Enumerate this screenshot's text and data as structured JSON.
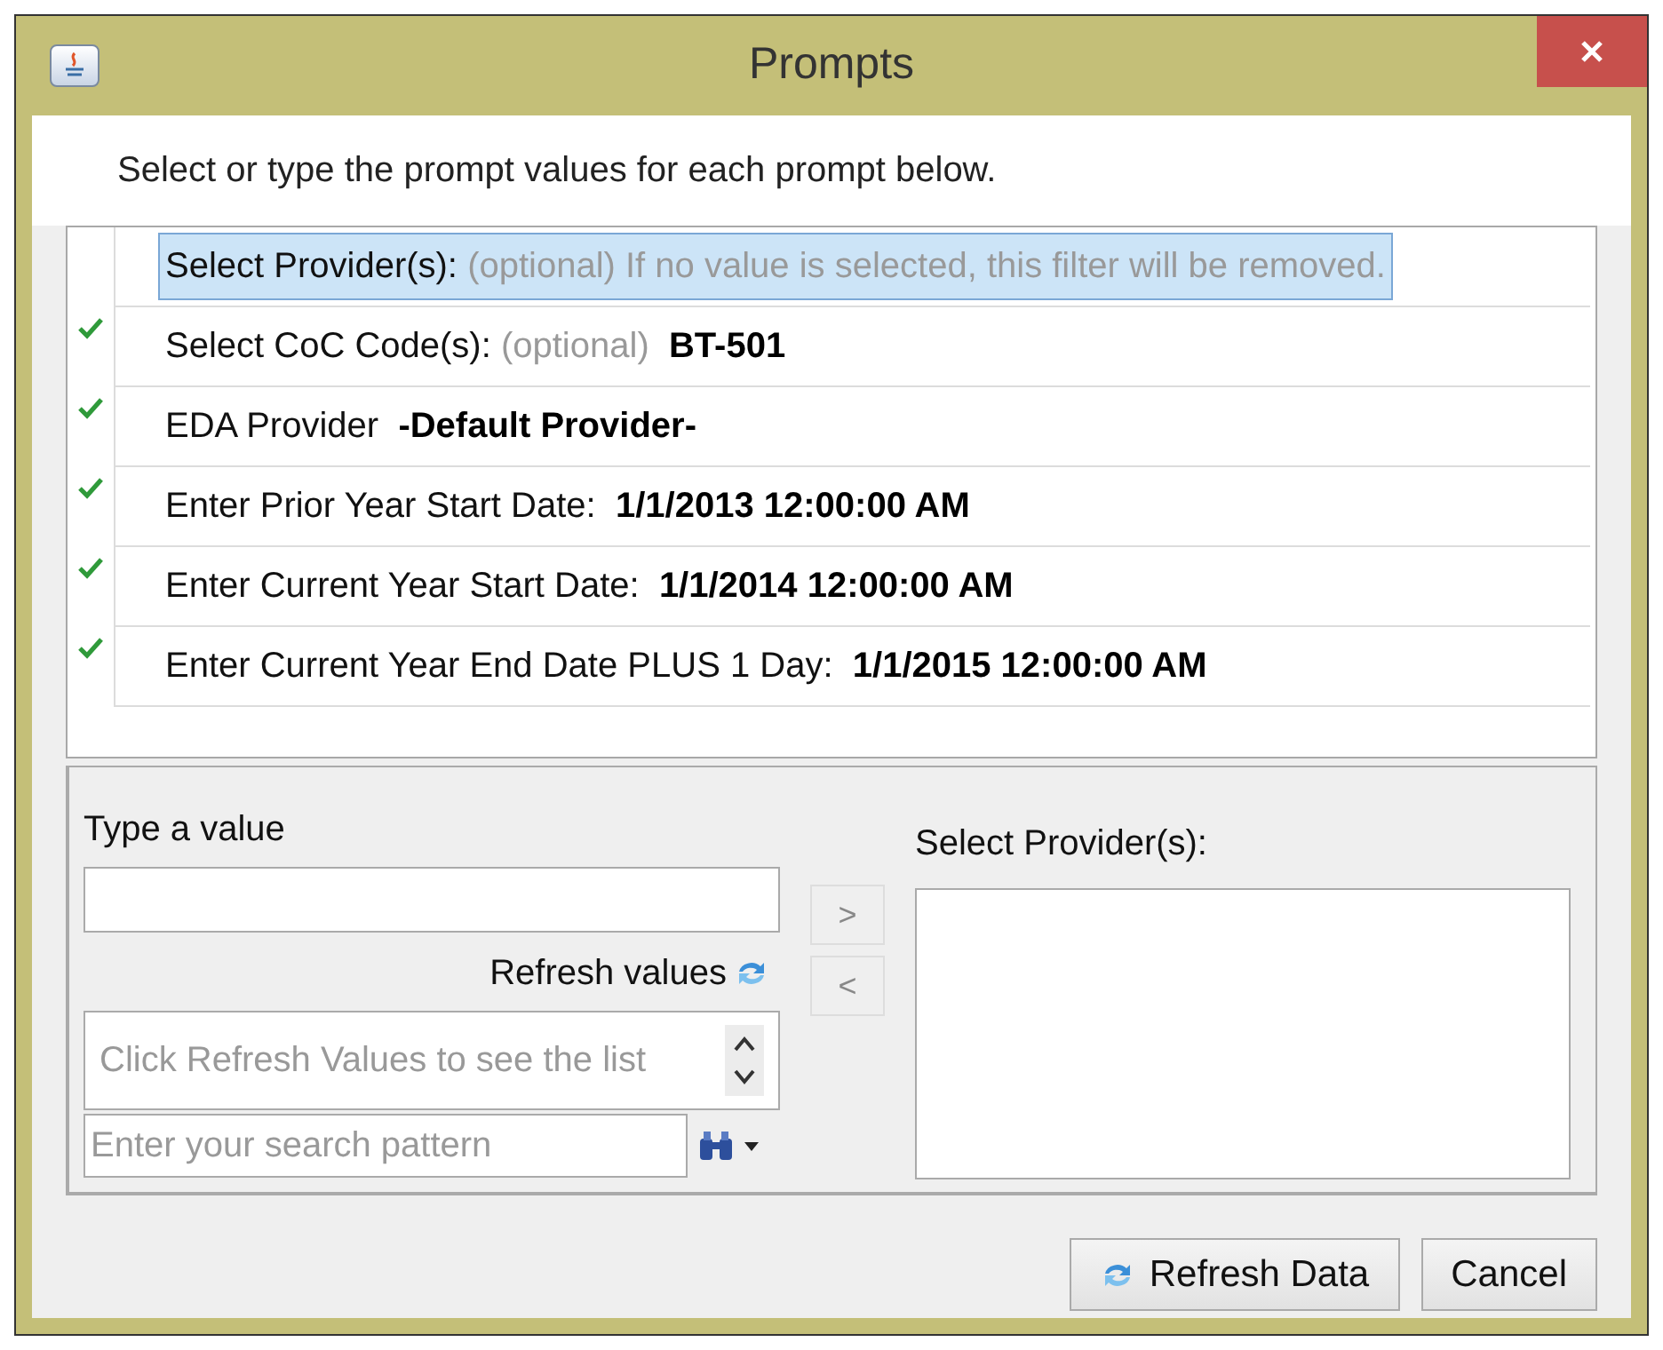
{
  "window": {
    "title": "Prompts"
  },
  "instruction": "Select or type the prompt values for each prompt below.",
  "prompts": [
    {
      "label": "Select Provider(s):",
      "hint": "(optional) If no value is selected, this filter will be removed.",
      "answered": false,
      "selected": true
    },
    {
      "label": "Select CoC Code(s):",
      "hint": "(optional)",
      "value": "BT-501",
      "answered": true,
      "selected": false
    },
    {
      "label": "EDA Provider",
      "value": "-Default Provider-",
      "answered": true,
      "selected": false
    },
    {
      "label": "Enter Prior Year Start Date:",
      "value": "1/1/2013 12:00:00 AM",
      "answered": true,
      "selected": false
    },
    {
      "label": "Enter Current Year Start Date:",
      "value": "1/1/2014 12:00:00 AM",
      "answered": true,
      "selected": false
    },
    {
      "label": "Enter Current Year End Date PLUS 1 Day:",
      "value": "1/1/2015 12:00:00 AM",
      "answered": true,
      "selected": false
    }
  ],
  "editor": {
    "type_label": "Type a value",
    "refresh_values": "Refresh values",
    "list_placeholder": "Click Refresh Values to see the list",
    "search_placeholder": "Enter your search pattern",
    "add": ">",
    "remove": "<",
    "selected_label": "Select Provider(s):"
  },
  "buttons": [
    {
      "label": "Refresh Data",
      "kind": "refresh"
    },
    {
      "label": "Cancel",
      "kind": "plain"
    }
  ]
}
